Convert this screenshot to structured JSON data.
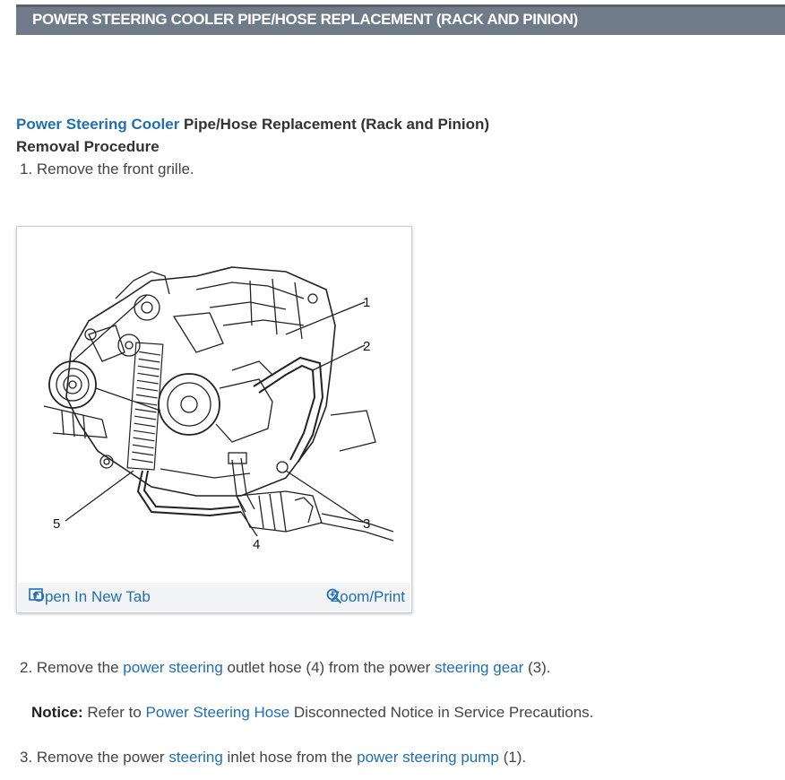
{
  "header": {
    "title": "POWER STEERING COOLER PIPE/HOSE REPLACEMENT (RACK AND PINION)"
  },
  "section": {
    "title_link": "Power Steering Cooler",
    "title_rest": " Pipe/Hose Replacement (Rack and Pinion)",
    "subtitle": "Removal Procedure"
  },
  "steps": {
    "s1": "1. Remove the front grille.",
    "s2_a": "2. Remove the ",
    "s2_link1": "power steering",
    "s2_b": " outlet hose (4) from the power ",
    "s2_link2": "steering gear",
    "s2_c": " (3).",
    "notice_label": "Notice:",
    "notice_a": " Refer to ",
    "notice_link": "Power Steering Hose",
    "notice_b": " Disconnected Notice in Service Precautions.",
    "s3_a": "3. Remove the power ",
    "s3_link1": "steering",
    "s3_b": " inlet hose from the ",
    "s3_link2": "power steering pump",
    "s3_c": " (1)."
  },
  "figure": {
    "callouts": [
      "1",
      "2",
      "3",
      "4",
      "5"
    ],
    "open_tab_label": "Open In New Tab",
    "zoom_label": "Zoom/Print",
    "open_tab_icon": "open-new-tab-icon",
    "zoom_icon": "zoom-magnifier-icon"
  },
  "colors": {
    "title_bar": "#6f7b88",
    "link": "#1f6fb4"
  }
}
